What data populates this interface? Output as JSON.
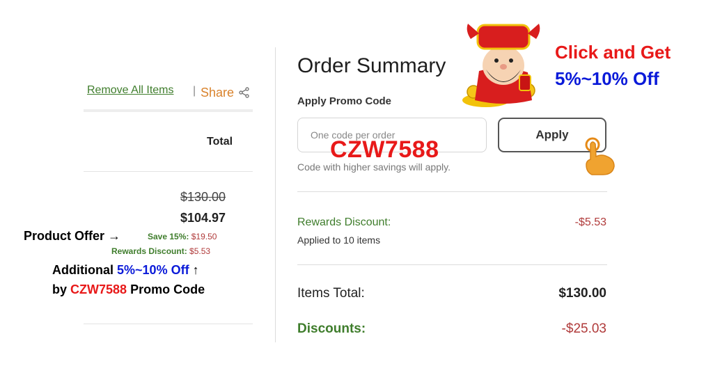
{
  "cart": {
    "remove_all": "Remove All Items",
    "separator": "|",
    "share": "Share",
    "total_header": "Total",
    "original_price": "$130.00",
    "sale_price": "$104.97",
    "save_label": "Save 15%:",
    "save_value": "$19.50",
    "rewards_label": "Rewards Discount:",
    "rewards_value": "$5.53"
  },
  "annotations": {
    "product_offer": "Product Offer",
    "arrow_right": "→",
    "additional": "Additional",
    "percent_off": "5%~10% Off",
    "arrow_up": "↑",
    "by": "by",
    "promo_code": "CZW7588",
    "promo_code_suffix": "Promo Code",
    "cta_line1": "Click and Get",
    "cta_line2": "5%~10% Off",
    "code_overlay": "CZW7588"
  },
  "summary": {
    "title": "Order Summary",
    "apply_promo_label": "Apply Promo Code",
    "input_placeholder": "One code per order",
    "apply_button": "Apply",
    "hint": "Code with higher savings will apply.",
    "rewards_discount_label": "Rewards Discount:",
    "rewards_discount_value": "-$5.53",
    "applied_to": "Applied to 10 items",
    "items_total_label": "Items Total:",
    "items_total_value": "$130.00",
    "discounts_label": "Discounts:",
    "discounts_value": "-$25.03"
  },
  "colors": {
    "green": "#3f7d2c",
    "price_red": "#b03a3a",
    "share_orange": "#d9822b",
    "annotation_red": "#e81919",
    "annotation_blue": "#0a1ad9"
  },
  "icons": [
    "share-icon",
    "fortune-god-mascot",
    "pointing-hand-icon"
  ]
}
